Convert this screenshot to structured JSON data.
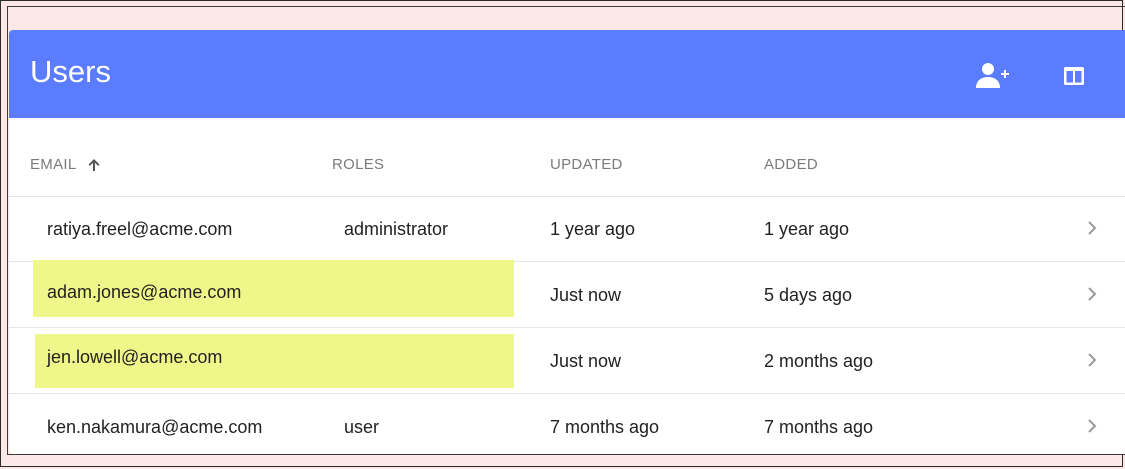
{
  "header": {
    "title": "Users",
    "add_user_icon": "add-user-icon",
    "columns_icon": "view-columns-icon"
  },
  "table": {
    "columns": [
      {
        "label": "EMAIL",
        "sorted": "ascending"
      },
      {
        "label": "ROLES"
      },
      {
        "label": "UPDATED"
      },
      {
        "label": "ADDED"
      }
    ],
    "rows": [
      {
        "email": "ratiya.freel@acme.com",
        "roles": "administrator",
        "updated": "1 year ago",
        "added": "1 year ago",
        "highlighted": false
      },
      {
        "email": "adam.jones@acme.com",
        "roles": "",
        "updated": "Just now",
        "added": "5 days ago",
        "highlighted": true
      },
      {
        "email": "jen.lowell@acme.com",
        "roles": "",
        "updated": "Just now",
        "added": "2 months ago",
        "highlighted": true
      },
      {
        "email": "ken.nakamura@acme.com",
        "roles": "user",
        "updated": "7 months ago",
        "added": "7 months ago",
        "highlighted": false
      }
    ]
  },
  "colors": {
    "header_bg": "#5b7cff",
    "highlight": "#f0f78a",
    "page_bg": "#fde8e8"
  }
}
